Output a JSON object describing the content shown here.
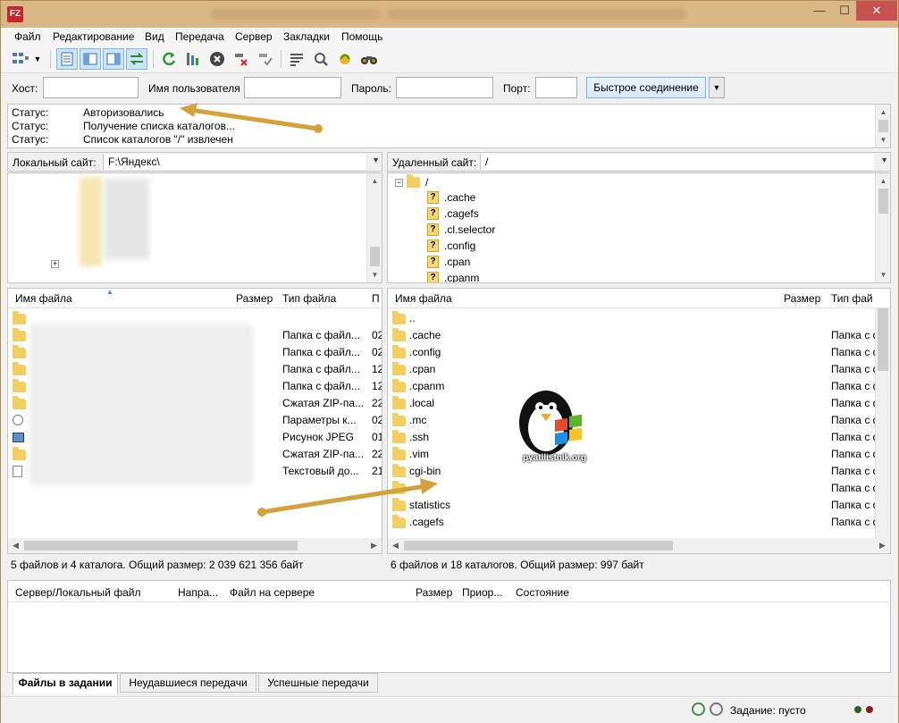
{
  "window": {
    "app_icon": "filezilla-icon",
    "controls": {
      "minimize": "—",
      "maximize": "☐",
      "close": "✕"
    }
  },
  "menu": [
    "Файл",
    "Редактирование",
    "Вид",
    "Передача",
    "Сервер",
    "Закладки",
    "Помощь"
  ],
  "quickconnect": {
    "host_label": "Хост:",
    "host_value": "",
    "user_label": "Имя пользователя",
    "user_value": "",
    "password_label": "Пароль:",
    "password_value": "",
    "port_label": "Порт:",
    "port_value": "",
    "button": "Быстрое соединение",
    "dropdown": "▼"
  },
  "log": [
    {
      "key": "Статус:",
      "value": "Авторизовались"
    },
    {
      "key": "Статус:",
      "value": "Получение списка каталогов..."
    },
    {
      "key": "Статус:",
      "value": "Список каталогов \"/\" извлечен"
    }
  ],
  "local": {
    "site_label": "Локальный сайт:",
    "site_path": "F:\\Яндекс\\",
    "columns": [
      "Имя файла",
      "Размер",
      "Тип файла",
      "П"
    ],
    "rows": [
      {
        "type": "",
        "modified": ""
      },
      {
        "type": "Папка с файл...",
        "modified": "02"
      },
      {
        "type": "Папка с файл...",
        "modified": "02"
      },
      {
        "type": "Папка с файл...",
        "modified": "12"
      },
      {
        "type": "Папка с файл...",
        "modified": "12"
      },
      {
        "type": "Сжатая ZIP-па...",
        "modified": "22"
      },
      {
        "type": "Параметры к...",
        "modified": "02"
      },
      {
        "type": "Рисунок JPEG",
        "modified": "01"
      },
      {
        "type": "Сжатая ZIP-па...",
        "modified": "22"
      },
      {
        "type": "Текстовый до...",
        "modified": "21"
      }
    ],
    "status": "5 файлов и 4 каталога. Общий размер: 2 039 621 356 байт"
  },
  "remote": {
    "site_label": "Удаленный сайт:",
    "site_path": "/",
    "tree_root": "/",
    "tree": [
      ".cache",
      ".cagefs",
      ".cl.selector",
      ".config",
      ".cpan",
      ".cpanm"
    ],
    "columns": [
      "Имя файла",
      "Размер",
      "Тип фай"
    ],
    "rows": [
      {
        "name": "..",
        "type": ""
      },
      {
        "name": ".cache",
        "type": "Папка с ф"
      },
      {
        "name": ".config",
        "type": "Папка с ф"
      },
      {
        "name": ".cpan",
        "type": "Папка с ф"
      },
      {
        "name": ".cpanm",
        "type": "Папка с ф"
      },
      {
        "name": ".local",
        "type": "Папка с ф"
      },
      {
        "name": ".mc",
        "type": "Папка с ф"
      },
      {
        "name": ".ssh",
        "type": "Папка с ф"
      },
      {
        "name": ".vim",
        "type": "Папка с ф"
      },
      {
        "name": "cgi-bin",
        "type": "Папка с ф"
      },
      {
        "name": "",
        "type": "Папка с ф"
      },
      {
        "name": "statistics",
        "type": "Папка с ф"
      },
      {
        "name": ".cagefs",
        "type": "Папка с ф"
      }
    ],
    "status": "6 файлов и 18 каталогов. Общий размер: 997 байт"
  },
  "queue": {
    "columns": [
      "Сервер/Локальный файл",
      "Напра...",
      "Файл на сервере",
      "Размер",
      "Приор...",
      "Состояние"
    ]
  },
  "tabs": [
    "Файлы в задании",
    "Неудавшиеся передачи",
    "Успешные передачи"
  ],
  "statusbar": {
    "task": "Задание: пусто"
  },
  "watermark": {
    "text": "pyatilistnik.org"
  },
  "colors": {
    "arrow": "#d4a23d",
    "accent": "#7eb4ea",
    "close": "#c75050"
  }
}
